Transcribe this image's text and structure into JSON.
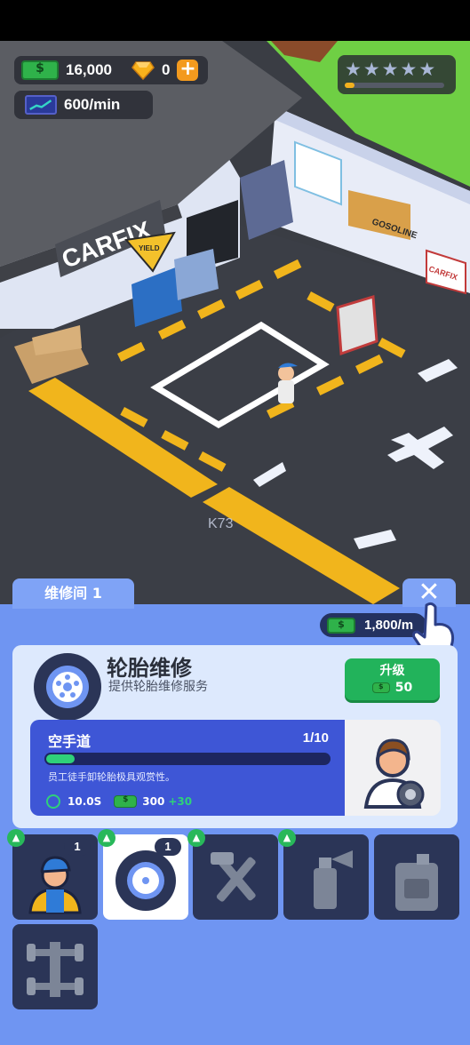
{
  "hud": {
    "money": "16,000",
    "gems": "0",
    "plus": "+",
    "rate": "600/min",
    "stars": [
      "★",
      "★",
      "★",
      "★",
      "★"
    ],
    "star_progress": 0.1
  },
  "scene": {
    "sign_main": "CARFIX",
    "sign_yield": "YIELD",
    "poster_right_top": "GOSOLINE",
    "poster_right": "CARFIX",
    "watermark": "K73"
  },
  "room": {
    "tab_label": "维修间 1",
    "close_label": "✕",
    "income_rate": "1,800/m"
  },
  "station": {
    "title": "轮胎维修",
    "subtitle": "提供轮胎维修服务",
    "upgrade_label": "升级",
    "upgrade_cost": "50"
  },
  "task": {
    "name": "空手道",
    "count": "1/10",
    "progress": 0.1,
    "description": "员工徒手卸轮胎极具观赏性。",
    "time": "10.0S",
    "reward": "300",
    "bonus": "+30"
  },
  "slots": [
    {
      "icon": "worker-icon",
      "level": "1",
      "selected": false,
      "locked": false
    },
    {
      "icon": "tire-icon",
      "level": "1",
      "selected": true,
      "locked": false
    },
    {
      "icon": "tools-icon",
      "level": "",
      "selected": false,
      "locked": true
    },
    {
      "icon": "spray-can-icon",
      "level": "",
      "selected": false,
      "locked": true
    },
    {
      "icon": "oil-can-icon",
      "level": "",
      "selected": false,
      "locked": true
    },
    {
      "icon": "chassis-icon",
      "level": "",
      "selected": false,
      "locked": true
    }
  ],
  "colors": {
    "panel": "#6f95f2",
    "card": "#dde9fd",
    "task": "#3e56d6",
    "upgrade": "#22b35b",
    "slot": "#2b3557"
  }
}
